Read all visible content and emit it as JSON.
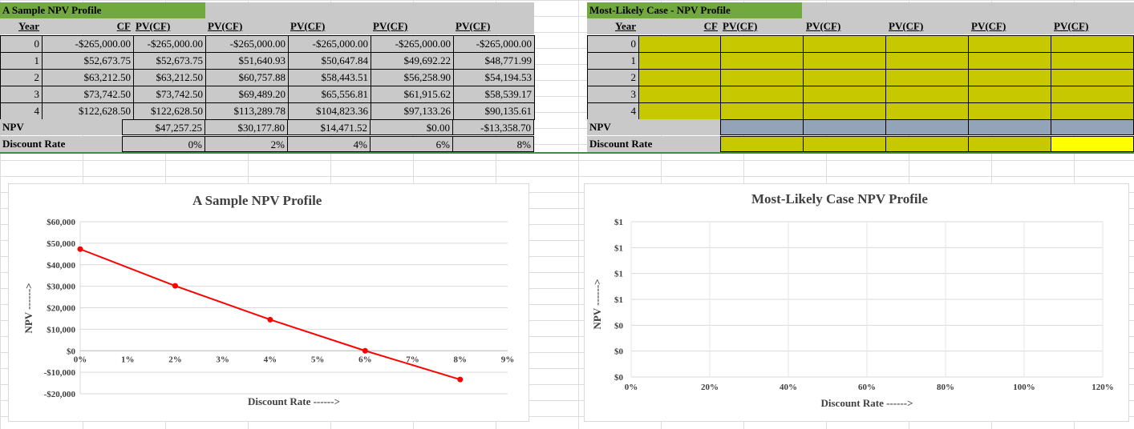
{
  "left_table": {
    "title": "A Sample NPV Profile",
    "headers": [
      "Year",
      "CF",
      "PV(CF)",
      "PV(CF)",
      "PV(CF)",
      "PV(CF)",
      "PV(CF)"
    ],
    "rows": [
      [
        "0",
        "-$265,000.00",
        "-$265,000.00",
        "-$265,000.00",
        "-$265,000.00",
        "-$265,000.00",
        "-$265,000.00"
      ],
      [
        "1",
        "$52,673.75",
        "$52,673.75",
        "$51,640.93",
        "$50,647.84",
        "$49,692.22",
        "$48,771.99"
      ],
      [
        "2",
        "$63,212.50",
        "$63,212.50",
        "$60,757.88",
        "$58,443.51",
        "$56,258.90",
        "$54,194.53"
      ],
      [
        "3",
        "$73,742.50",
        "$73,742.50",
        "$69,489.20",
        "$65,556.81",
        "$61,915.62",
        "$58,539.17"
      ],
      [
        "4",
        "$122,628.50",
        "$122,628.50",
        "$113,289.78",
        "$104,823.36",
        "$97,133.26",
        "$90,135.61"
      ]
    ],
    "npv_label": "NPV",
    "npv_values": [
      "$47,257.25",
      "$30,177.80",
      "$14,471.52",
      "$0.00",
      "-$13,358.70"
    ],
    "rate_label": "Discount Rate",
    "rates": [
      "0%",
      "2%",
      "4%",
      "6%",
      "8%"
    ]
  },
  "right_table": {
    "title": "Most-Likely Case - NPV Profile",
    "headers": [
      "Year",
      "CF",
      "PV(CF)",
      "PV(CF)",
      "PV(CF)",
      "PV(CF)",
      "PV(CF)"
    ],
    "years": [
      "0",
      "1",
      "2",
      "3",
      "4"
    ],
    "npv_label": "NPV",
    "rate_label": "Discount Rate"
  },
  "colors": {
    "title_green": "#71a93e",
    "input_olive": "#c8c800",
    "npv_slate": "#93a4b8",
    "highlight_yellow": "#ffff00",
    "series_red": "#ff0000"
  },
  "chart_data": [
    {
      "type": "line",
      "title": "A Sample NPV Profile",
      "xlabel": "Discount Rate ------>",
      "ylabel": "NPV ------>",
      "x": [
        0,
        2,
        4,
        6,
        8
      ],
      "values": [
        47257.25,
        30177.8,
        14471.52,
        0.0,
        -13358.7
      ],
      "x_ticks": [
        "0%",
        "1%",
        "2%",
        "3%",
        "4%",
        "5%",
        "6%",
        "7%",
        "8%",
        "9%"
      ],
      "y_ticks": [
        "$60,000",
        "$50,000",
        "$40,000",
        "$30,000",
        "$20,000",
        "$10,000",
        "$0",
        "-$10,000",
        "-$20,000"
      ],
      "xlim": [
        0,
        9
      ],
      "ylim": [
        -20000,
        60000
      ],
      "grid": true
    },
    {
      "type": "line",
      "title": "Most-Likely Case NPV Profile",
      "xlabel": "Discount Rate ------>",
      "ylabel": "NPV ------>",
      "values": [],
      "x_ticks": [
        "0%",
        "20%",
        "40%",
        "60%",
        "80%",
        "100%",
        "120%"
      ],
      "y_ticks": [
        "$1",
        "$1",
        "$1",
        "$1",
        "$0",
        "$0",
        "$0"
      ],
      "xlim": [
        0,
        120
      ],
      "grid": true
    }
  ]
}
